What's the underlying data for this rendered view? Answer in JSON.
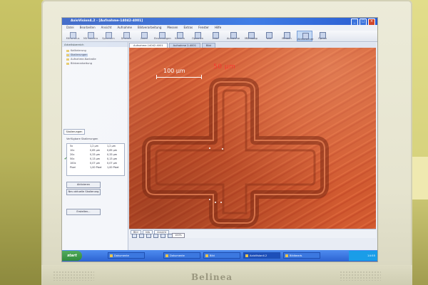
{
  "window": {
    "title": "AxioVision4.2 - [Aufnahme-14042-4001]",
    "buttons": [
      "_",
      "□",
      "×"
    ]
  },
  "menu": [
    "Datei",
    "Bearbeiten",
    "Ansicht",
    "Aufnahme",
    "Bildverarbeitung",
    "Messen",
    "Extras",
    "Fenster",
    "Hilfe"
  ],
  "toolbar": [
    "Mit AFocus",
    "Mit Kamera",
    "Speichern",
    "Drucken",
    "Zoom",
    "Einstellungen",
    "Kamera",
    "Optionen",
    "Ende",
    "Aufnahme",
    "Mikroskop",
    "Text",
    "Messen",
    "Ablaufsteuer",
    "Optika"
  ],
  "left_panel": {
    "header": "Arbeitsbereich",
    "tree": [
      "Kalibrierung",
      "Skalierungen",
      "Aufnahme-Kontrolle",
      "Bildverarbeitung"
    ],
    "tab": "Skalierungen",
    "props_label": "Verfügbare Skalierungen",
    "table_rows": [
      {
        "name": "5x",
        "a": "1,2 µm",
        "b": "1,2 µm",
        "checked": false
      },
      {
        "name": "10x",
        "a": "0,65 µm",
        "b": "0,65 µm",
        "checked": false
      },
      {
        "name": "20x",
        "a": "0,33 µm",
        "b": "0,33 µm",
        "checked": false
      },
      {
        "name": "50x",
        "a": "0,13 µm",
        "b": "0,13 µm",
        "checked": true
      },
      {
        "name": "100x",
        "a": "0,07 µm",
        "b": "0,07 µm",
        "checked": false
      },
      {
        "name": "Pixel",
        "a": "1,00 Pixel",
        "b": "1,00 Pixel",
        "checked": false
      }
    ],
    "buttons": [
      "Aktivieren",
      "Neu aktuelle Skalierung",
      "Erstellen..."
    ]
  },
  "document": {
    "tabs": [
      "Aufnahme-14042-4001",
      "Aufnahme 2-4001",
      "Bild"
    ],
    "scale_label": "100 µm",
    "overlay_text": "50 µm",
    "status_tabs": [
      "Bild",
      "Info",
      "Ansicht"
    ],
    "zoom": "100%"
  },
  "taskbar": {
    "start": "start",
    "tasks": [
      "Dokumente",
      "Dokumente",
      "Bild",
      "AxioVision4.2",
      "Bildbearb."
    ],
    "clock": "14:55"
  },
  "monitor": {
    "brand": "Belinea"
  }
}
